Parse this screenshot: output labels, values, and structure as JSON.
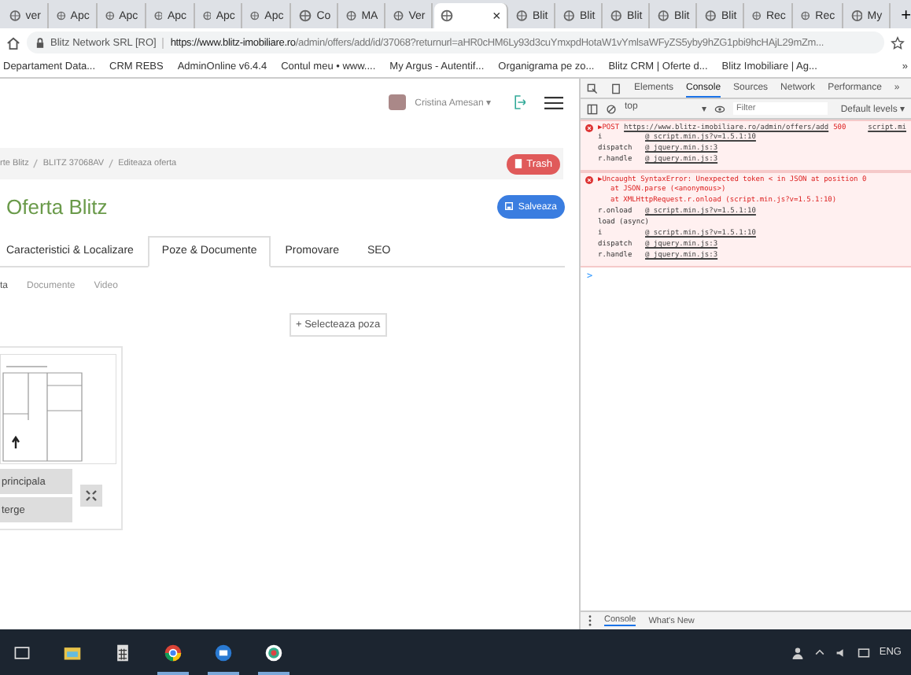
{
  "browser_tabs": [
    {
      "label": "ver",
      "selected": false
    },
    {
      "label": "Apc",
      "selected": false
    },
    {
      "label": "Apc",
      "selected": false
    },
    {
      "label": "Apc",
      "selected": false
    },
    {
      "label": "Apc",
      "selected": false
    },
    {
      "label": "Apc",
      "selected": false
    },
    {
      "label": "Co",
      "selected": false
    },
    {
      "label": "MA",
      "selected": false
    },
    {
      "label": "Ver",
      "selected": false
    },
    {
      "selected": true,
      "close": "×"
    },
    {
      "label": "Blit",
      "selected": false
    },
    {
      "label": "Blit",
      "selected": false
    },
    {
      "label": "Blit",
      "selected": false
    },
    {
      "label": "Blit",
      "selected": false
    },
    {
      "label": "Blit",
      "selected": false
    },
    {
      "label": "Rec",
      "selected": false
    },
    {
      "label": "Rec",
      "selected": false
    },
    {
      "label": "My",
      "selected": false
    }
  ],
  "new_tab": "+",
  "address_bar": {
    "site": "Blitz Network SRL [RO]",
    "url_host": "https://www.blitz-imobiliare.ro",
    "url_path": "/admin/offers/add/id/37068?returnurl=aHR0cHM6Ly93d3cuYmxpdHotaW1vYmlsaWFyZS5yby9hZG1pbi9hcHAjL29mZm..."
  },
  "bookmarks": [
    "Departament Data...",
    "CRM REBS",
    "AdminOnline v6.4.4",
    "Contul meu • www....",
    "My Argus - Autentif...",
    "Organigrama pe zo...",
    "Blitz CRM | Oferte d...",
    "Blitz Imobiliare | Ag..."
  ],
  "bookmarks_more": "»",
  "page": {
    "user": "Cristina Amesan ▾",
    "breadcrumbs": [
      "rte Blitz",
      "BLITZ 37068AV",
      "Editeaza oferta"
    ],
    "trash": "Trash",
    "title": "Oferta Blitz",
    "save": "Salveaza",
    "tabs": [
      {
        "label": "Caracteristici & Localizare",
        "selected": false
      },
      {
        "label": "Poze & Documente",
        "selected": true
      },
      {
        "label": "Promovare",
        "selected": false
      },
      {
        "label": "SEO",
        "selected": false
      }
    ],
    "subtabs": [
      {
        "label": "ta",
        "selected": true
      },
      {
        "label": "Documente",
        "selected": false
      },
      {
        "label": "Video",
        "selected": false
      }
    ],
    "select_photo": "+ Selecteaza poza",
    "photo_actions": [
      "principala",
      "terge"
    ]
  },
  "devtools": {
    "tabs": [
      {
        "label": "Elements",
        "selected": false
      },
      {
        "label": "Console",
        "selected": true
      },
      {
        "label": "Sources",
        "selected": false
      },
      {
        "label": "Network",
        "selected": false
      },
      {
        "label": "Performance",
        "selected": false
      }
    ],
    "tabs_more": "»",
    "context": "top",
    "context_caret": "▾",
    "filter_placeholder": "Filter",
    "levels": "Default levels ▾",
    "errors": [
      {
        "message": "▶POST",
        "url": "https://www.blitz-imobiliare.ro/admin/offers/add",
        "status": "500",
        "source": "script.mi",
        "lines": [
          {
            "kind": "frame",
            "fn": "i",
            "link": "@ script.min.js?v=1.5.1:10"
          },
          {
            "kind": "frame",
            "fn": "dispatch",
            "link": "@ jquery.min.js:3"
          },
          {
            "kind": "frame",
            "fn": "r.handle",
            "link": "@ jquery.min.js:3"
          }
        ]
      },
      {
        "message": "▶Uncaught SyntaxError: Unexpected token < in JSON at position 0",
        "lines": [
          {
            "kind": "text",
            "text": "at JSON.parse (<anonymous>)"
          },
          {
            "kind": "text",
            "text": "at XMLHttpRequest.r.onload (script.min.js?v=1.5.1:10)"
          },
          {
            "kind": "frame",
            "fn": "r.onload",
            "link": "@ script.min.js?v=1.5.1:10"
          },
          {
            "kind": "plain",
            "text": "load (async)"
          },
          {
            "kind": "frame",
            "fn": "i",
            "link": "@ script.min.js?v=1.5.1:10"
          },
          {
            "kind": "frame",
            "fn": "dispatch",
            "link": "@ jquery.min.js:3"
          },
          {
            "kind": "frame",
            "fn": "r.handle",
            "link": "@ jquery.min.js:3"
          }
        ]
      }
    ],
    "prompt": ">",
    "drawer_tabs": [
      {
        "label": "Console",
        "selected": true
      },
      {
        "label": "What's New",
        "selected": false
      }
    ]
  },
  "taskbar": {
    "language": "ENG"
  }
}
